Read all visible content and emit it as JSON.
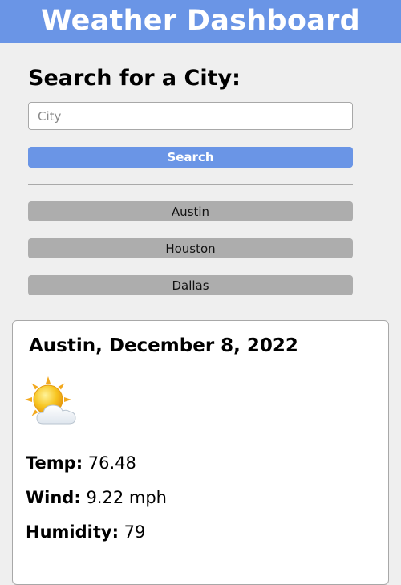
{
  "header": {
    "title": "Weather Dashboard"
  },
  "search": {
    "heading": "Search for a City:",
    "placeholder": "City",
    "button_label": "Search"
  },
  "history": [
    {
      "label": "Austin"
    },
    {
      "label": "Houston"
    },
    {
      "label": "Dallas"
    }
  ],
  "current": {
    "city_date": "Austin, December 8, 2022",
    "icon": "partly-cloudy-sun-icon",
    "temp_label": "Temp:",
    "temp_value": "76.48",
    "wind_label": "Wind:",
    "wind_value": "9.22 mph",
    "humidity_label": "Humidity:",
    "humidity_value": "79"
  },
  "colors": {
    "accent": "#6a95e6",
    "history_button": "#adadad",
    "background": "#efefef"
  }
}
